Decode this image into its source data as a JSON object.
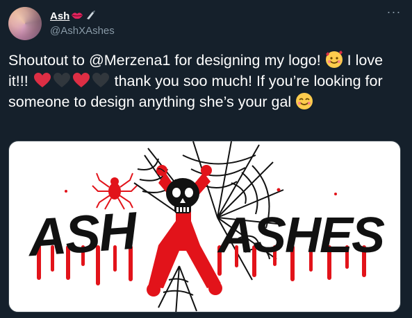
{
  "tweet": {
    "display_name": "Ash",
    "name_emojis": [
      "lips-emoji",
      "knife-emoji"
    ],
    "handle": "@AshXAshes",
    "more_label": "More",
    "text_segments": {
      "s1": "Shoutout to @Merzena1 for designing my logo! ",
      "s2": " I love it!!! ",
      "s3": " thank you soo much! If you’re looking for someone to design anything she’s your gal ",
      "emojis": [
        "smiling-face-with-hearts",
        "red-heart",
        "black-heart",
        "red-heart",
        "black-heart",
        "smiling-face-with-smiling-eyes"
      ]
    },
    "media": {
      "logo_text_left": "ASH",
      "logo_text_right": "ASHES",
      "accent_red": "#e2131a",
      "ink": "#111111"
    }
  },
  "theme": {
    "background": "#15202b",
    "secondary_text": "#8899a6",
    "text": "#ffffff"
  }
}
